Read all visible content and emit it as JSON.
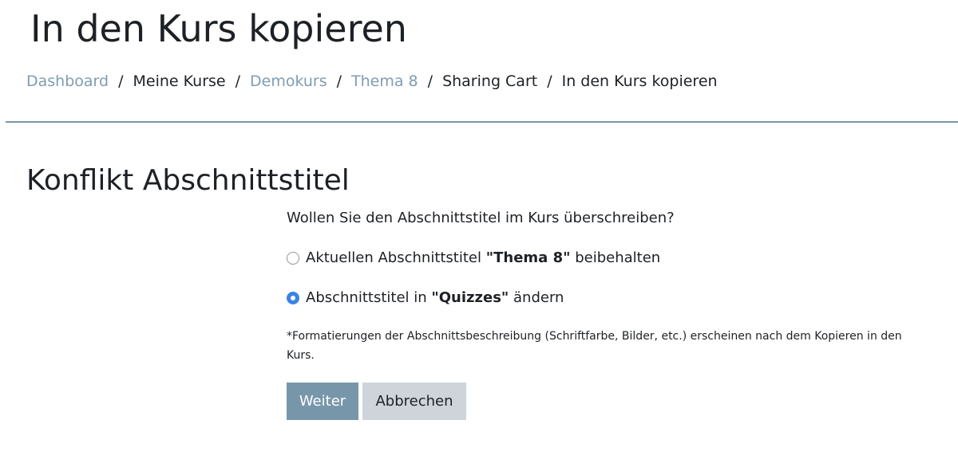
{
  "page": {
    "title": "In den Kurs kopieren"
  },
  "breadcrumb": {
    "items": [
      {
        "label": "Dashboard",
        "link": true
      },
      {
        "label": "Meine Kurse",
        "link": false
      },
      {
        "label": "Demokurs",
        "link": true
      },
      {
        "label": "Thema 8",
        "link": true
      },
      {
        "label": "Sharing Cart",
        "link": false
      },
      {
        "label": "In den Kurs kopieren",
        "link": false
      }
    ],
    "separator": "/"
  },
  "section": {
    "heading": "Konflikt Abschnittstitel"
  },
  "form": {
    "question": "Wollen Sie den Abschnittstitel im Kurs überschreiben?",
    "options": [
      {
        "prefix": "Aktuellen Abschnittstitel ",
        "bold": "\"Thema 8\"",
        "suffix": " beibehalten",
        "checked": false
      },
      {
        "prefix": "Abschnittstitel in ",
        "bold": "\"Quizzes\"",
        "suffix": " ändern",
        "checked": true
      }
    ],
    "note": "*Formatierungen der Abschnittsbeschreibung (Schriftfarbe, Bilder, etc.) erscheinen nach dem Kopieren in den Kurs.",
    "submit_label": "Weiter",
    "cancel_label": "Abbrechen"
  },
  "colors": {
    "link": "#7f9db3",
    "divider": "#7a97ab",
    "primary_button": "#7896aa",
    "secondary_button": "#ced4da",
    "radio_checked": "#3a83e6"
  }
}
